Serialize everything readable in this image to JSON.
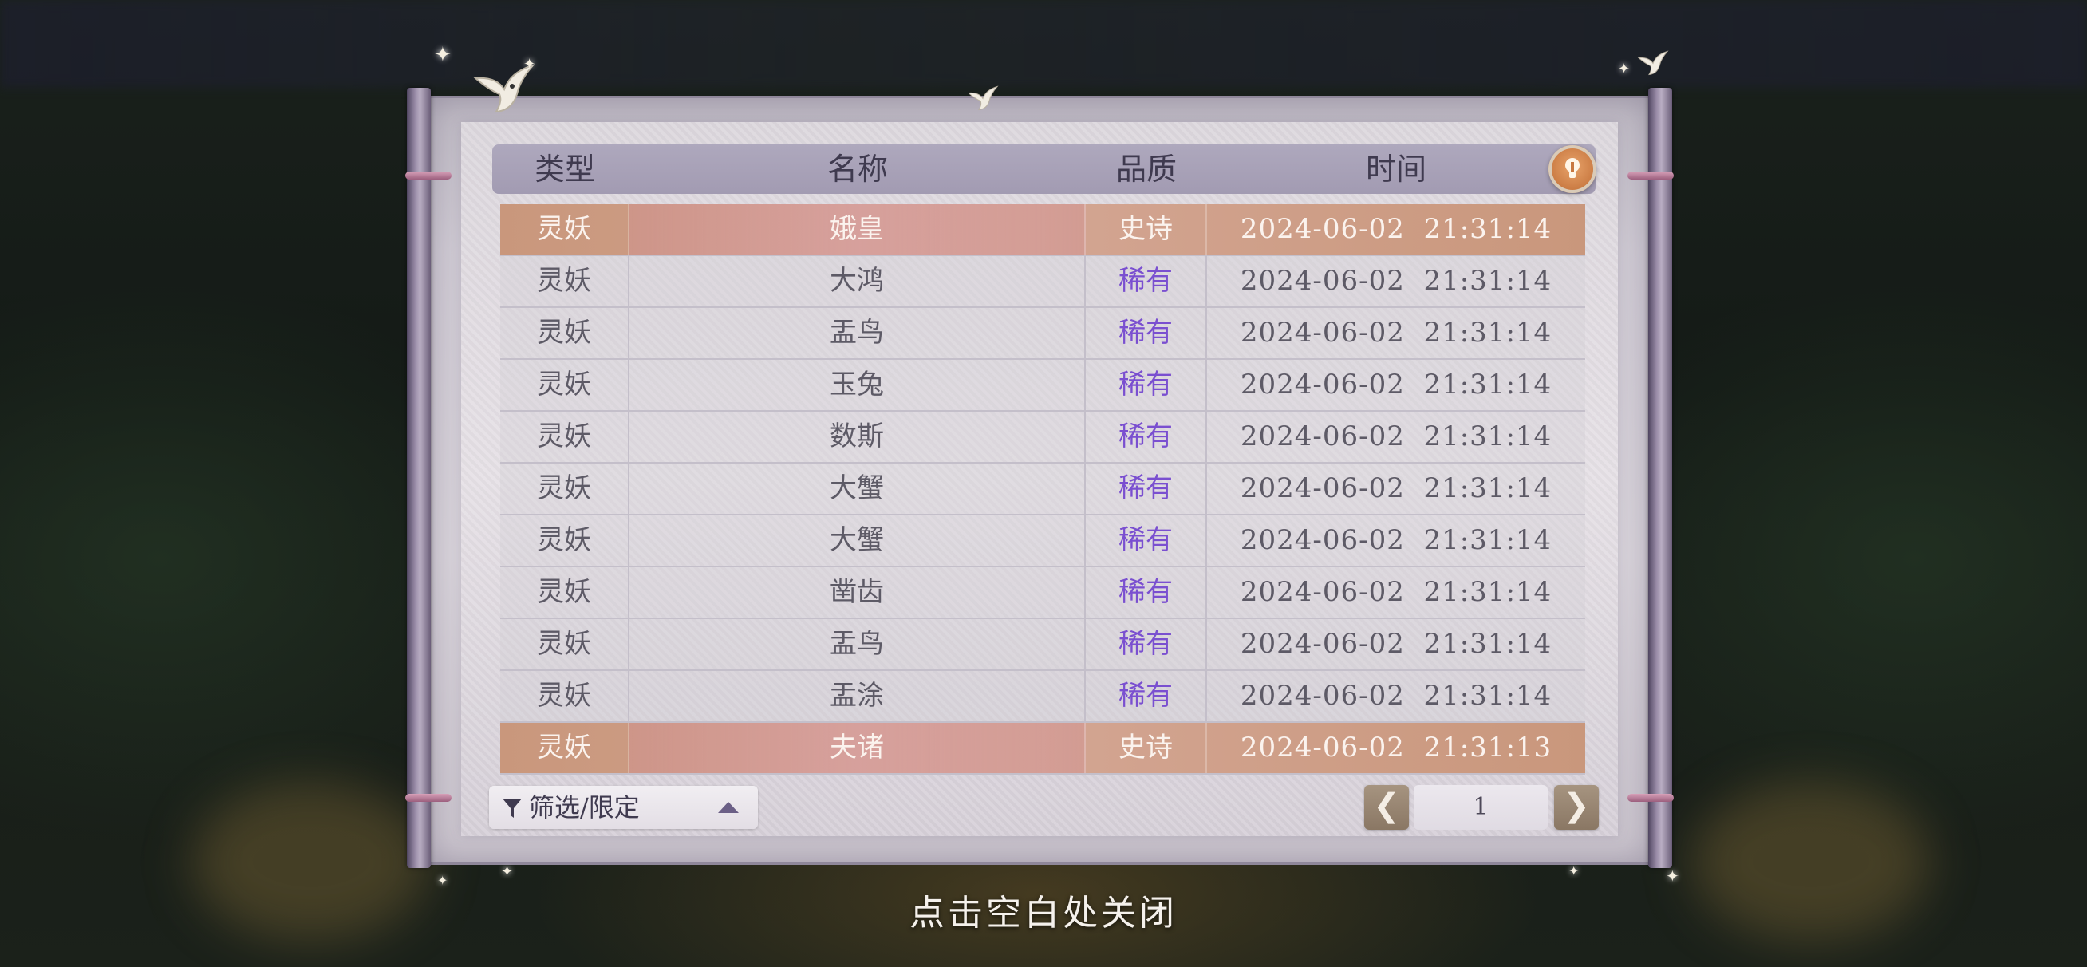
{
  "header": {
    "col_type": "类型",
    "col_name": "名称",
    "col_quality": "品质",
    "col_time": "时间"
  },
  "rows": [
    {
      "type": "灵妖",
      "name": "娥皇",
      "quality": "史诗",
      "time": "2024-06-02  21:31:14",
      "rarity": "epic"
    },
    {
      "type": "灵妖",
      "name": "大鸿",
      "quality": "稀有",
      "time": "2024-06-02  21:31:14",
      "rarity": "rare"
    },
    {
      "type": "灵妖",
      "name": "盂鸟",
      "quality": "稀有",
      "time": "2024-06-02  21:31:14",
      "rarity": "rare"
    },
    {
      "type": "灵妖",
      "name": "玉兔",
      "quality": "稀有",
      "time": "2024-06-02  21:31:14",
      "rarity": "rare"
    },
    {
      "type": "灵妖",
      "name": "数斯",
      "quality": "稀有",
      "time": "2024-06-02  21:31:14",
      "rarity": "rare"
    },
    {
      "type": "灵妖",
      "name": "大蟹",
      "quality": "稀有",
      "time": "2024-06-02  21:31:14",
      "rarity": "rare"
    },
    {
      "type": "灵妖",
      "name": "大蟹",
      "quality": "稀有",
      "time": "2024-06-02  21:31:14",
      "rarity": "rare"
    },
    {
      "type": "灵妖",
      "name": "凿齿",
      "quality": "稀有",
      "time": "2024-06-02  21:31:14",
      "rarity": "rare"
    },
    {
      "type": "灵妖",
      "name": "盂鸟",
      "quality": "稀有",
      "time": "2024-06-02  21:31:14",
      "rarity": "rare"
    },
    {
      "type": "灵妖",
      "name": "盂涂",
      "quality": "稀有",
      "time": "2024-06-02  21:31:14",
      "rarity": "rare"
    },
    {
      "type": "灵妖",
      "name": "夫诸",
      "quality": "史诗",
      "time": "2024-06-02  21:31:13",
      "rarity": "epic"
    }
  ],
  "filter": {
    "label": "筛选/限定",
    "icon": "funnel-icon",
    "toggle_icon": "triangle-up-icon"
  },
  "pager": {
    "prev_label": "❮",
    "next_label": "❯",
    "current_page": "1"
  },
  "close_hint": "点击空白处关闭",
  "colors": {
    "epic_row": "#d3a592",
    "rare_text": "#7a4fd0",
    "header_bg": "#a9a3b8",
    "hint_button": "#c87840"
  }
}
